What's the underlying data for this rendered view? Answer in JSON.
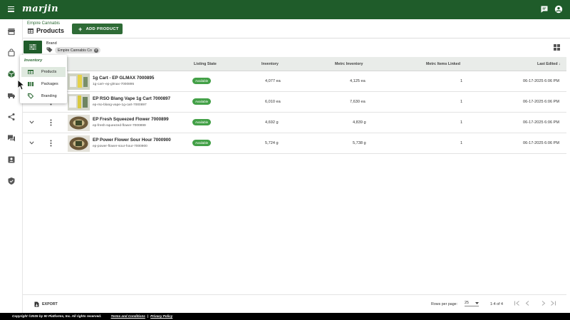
{
  "app": {
    "logo": "marjin",
    "colors": {
      "brand": "#1f5c2a",
      "accent": "#2e6b36",
      "available": "#43a047"
    }
  },
  "topbar": {
    "menu_icon": "menu-icon",
    "right_icons": [
      "chat-icon",
      "account-icon"
    ]
  },
  "sidebar": {
    "icons": [
      "store-icon",
      "shopping-bag-icon",
      "inventory-cube-icon",
      "truck-icon",
      "share-icon",
      "forum-icon",
      "badge-icon",
      "shield-icon"
    ]
  },
  "header": {
    "breadcrumb": "Empire Cannabis",
    "title": "Products",
    "add_button": "ADD PRODUCT"
  },
  "filters": {
    "brand_label": "Brand",
    "chip": "Empire Cannabis Co"
  },
  "table": {
    "columns": {
      "listing_state": "Listing State",
      "inventory": "Inventory",
      "metrc_inventory": "Metrc Inventory",
      "metrc_items_linked": "Metrc Items Linked",
      "last_edited": "Last Edited ↓"
    },
    "rows": [
      {
        "name": "1g Cart - EP GLMAX 7000895",
        "sku": "1g-cart--ep-glmax-7000895",
        "state": "Available",
        "inventory": "4,077 ea",
        "metrc": "4,125 ea",
        "linked": "1",
        "edited": "06-17-2025 6:06 PM"
      },
      {
        "name": "EP RSO Blang Vape 1g Cart 7000897",
        "sku": "ep-rso-blang-vape-1g-cart-7000897",
        "state": "Available",
        "inventory": "6,010 ea",
        "metrc": "7,630 ea",
        "linked": "1",
        "edited": "06-17-2025 6:06 PM"
      },
      {
        "name": "EP Fresh Squeezed Flower 7000899",
        "sku": "ep-fresh-squeezed-flower-7000899",
        "state": "Available",
        "inventory": "4,692 g",
        "metrc": "4,839 g",
        "linked": "1",
        "edited": "06-17-2025 6:06 PM"
      },
      {
        "name": "EP Power Flower Sour Hour 7000900",
        "sku": "ep-power-flower-sour-hour-7000900",
        "state": "Available",
        "inventory": "5,724 g",
        "metrc": "5,738 g",
        "linked": "1",
        "edited": "06-17-2025 6:06 PM"
      }
    ]
  },
  "dropdown": {
    "heading": "Inventory",
    "items": [
      {
        "label": "Products",
        "icon": "table-icon"
      },
      {
        "label": "Packages",
        "icon": "package-icon"
      },
      {
        "label": "Branding",
        "icon": "tag-icon"
      }
    ]
  },
  "footer": {
    "export": "EXPORT",
    "rows_per_page_label": "Rows per page:",
    "rows_per_page": "25",
    "range": "1-4 of 4"
  },
  "copyright": {
    "text": "Copyright ©2025 by 90 Platforms, Inc. All rights reserved.",
    "terms": "Terms and Conditions",
    "separator": "|",
    "privacy": "Privacy Policy"
  }
}
